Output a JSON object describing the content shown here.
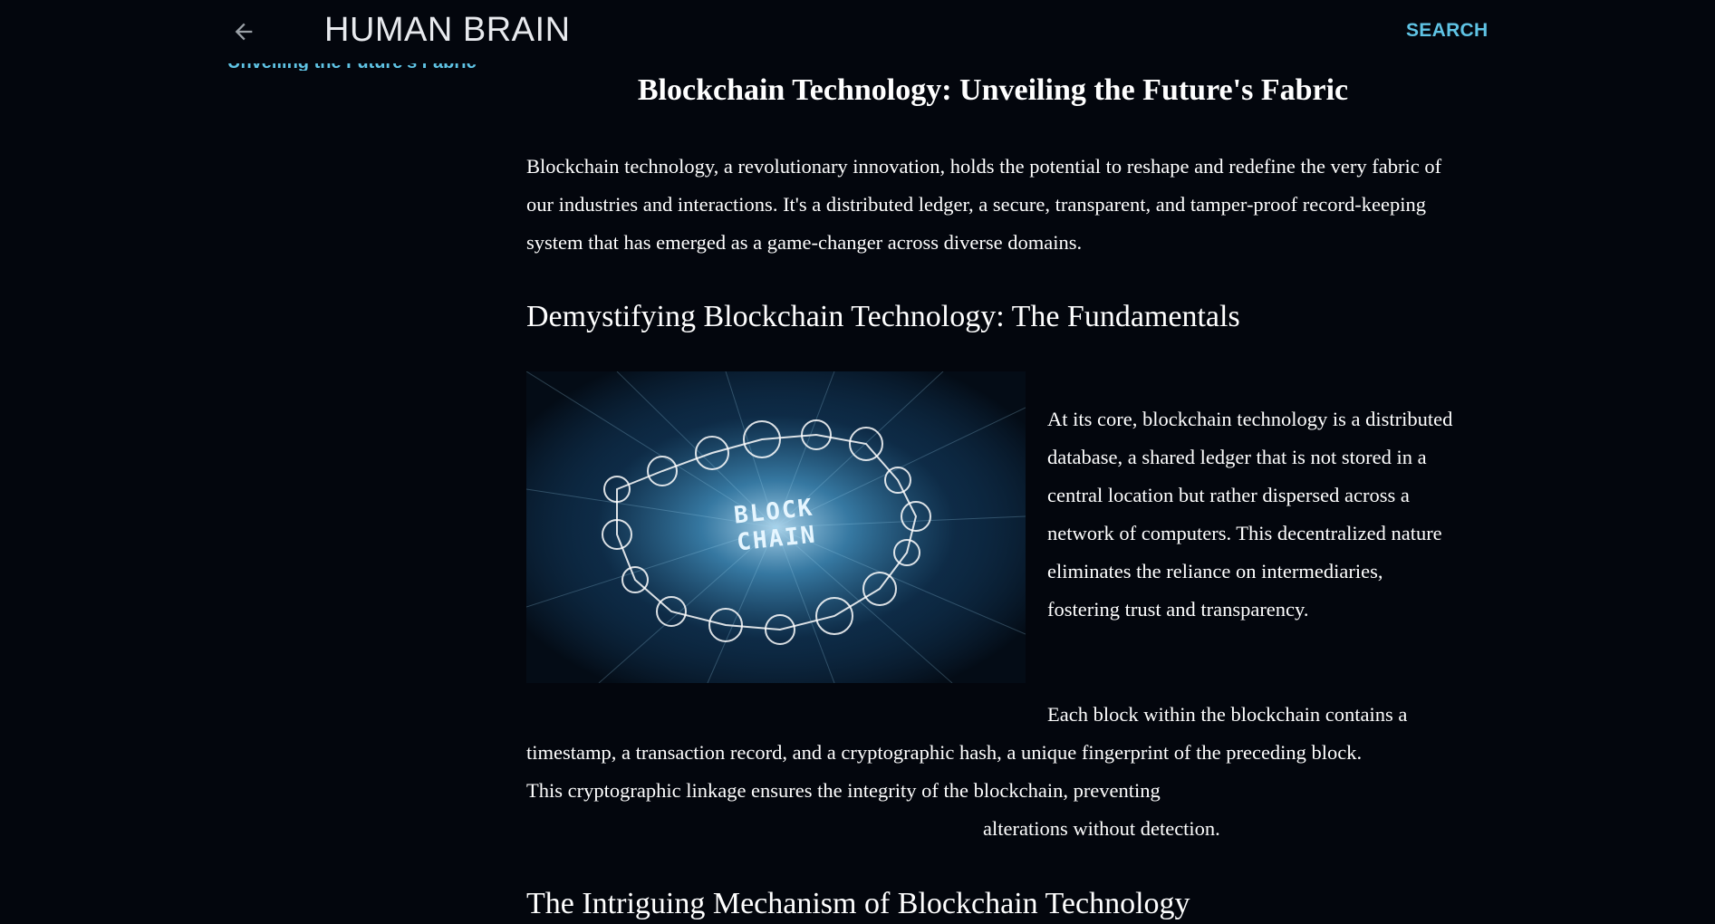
{
  "header": {
    "back_icon": "arrow-left-icon",
    "site_title": "HUMAN BRAIN",
    "search_label": "SEARCH"
  },
  "sidebar": {
    "current_post_link": "Unveiling the Future's Fabric"
  },
  "post": {
    "title": "Blockchain Technology: Unveiling the Future's Fabric",
    "intro": "Blockchain technology, a revolutionary innovation, holds the potential to reshape and redefine the very fabric of our industries and interactions. It's a distributed ledger, a secure, transparent, and tamper-proof record-keeping system that has emerged as a game-changer across diverse domains.",
    "section1_heading": "Demystifying Blockchain Technology: The Fundamentals",
    "image_text": "BLOCK CHAIN",
    "section1_para1": "At its core, blockchain technology is a distributed database, a shared ledger that is not stored in a central location but rather dispersed across a network of computers. This decentralized nature eliminates the reliance on intermediaries, fostering trust and transparency.",
    "section1_para2_lines": [
      "Each block within the blockchain contains a",
      "timestamp, a transaction record, and a cryptographic hash, a unique fingerprint of the preceding block.",
      "This cryptographic linkage ensures the integrity of the blockchain, preventing",
      "alterations without detection."
    ],
    "section2_heading": "The Intriguing Mechanism of Blockchain Technology"
  },
  "colors": {
    "background": "#03060d",
    "accent": "#5fc3e4",
    "text": "#ffffff"
  }
}
